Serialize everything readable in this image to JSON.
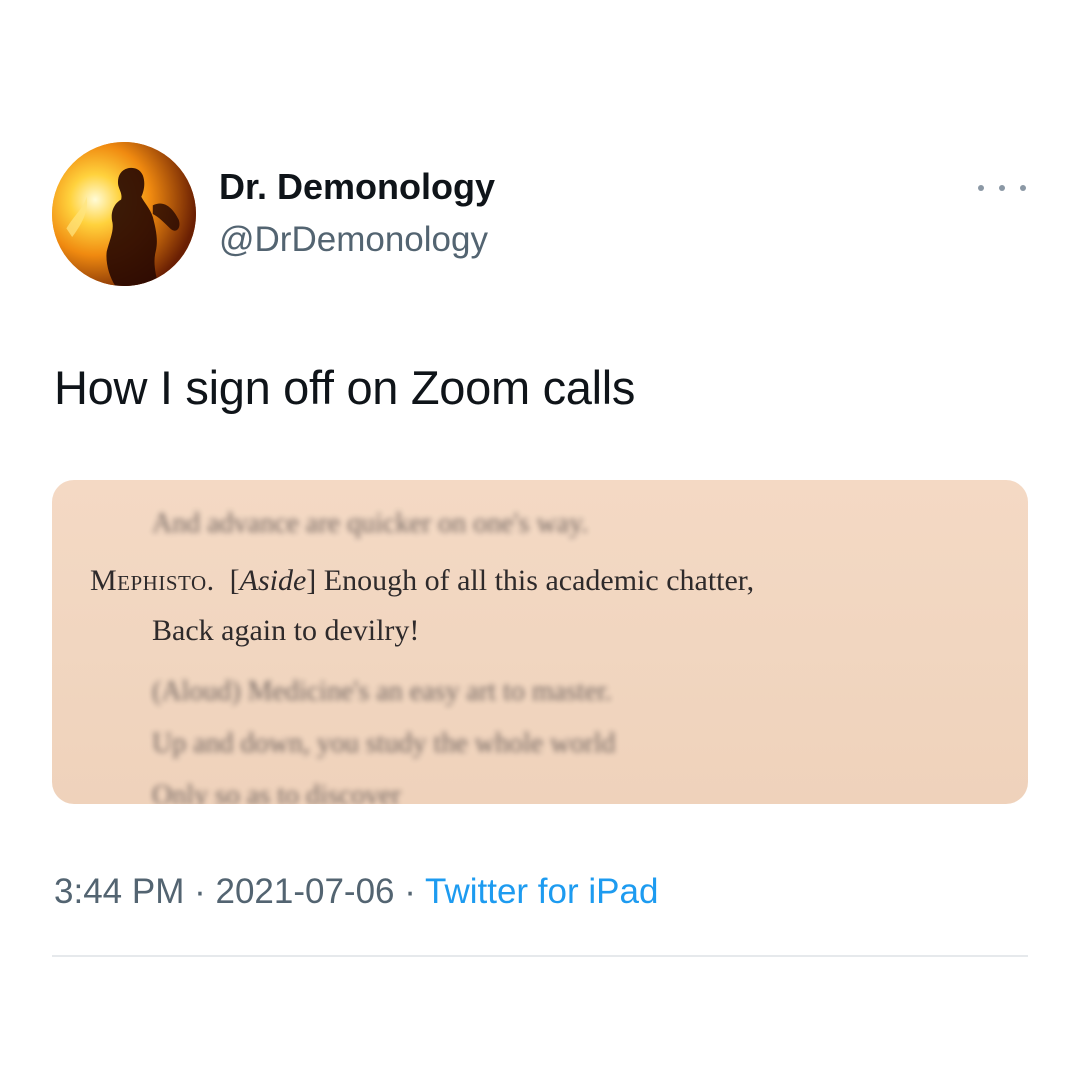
{
  "author": {
    "display_name": "Dr. Demonology",
    "handle": "@DrDemonology"
  },
  "tweet": {
    "text": "How I sign off on Zoom calls"
  },
  "media": {
    "blurred_top": "And advance are quicker on one's way.",
    "speaker": "Mephisto.",
    "aside": "Aside",
    "line1_rest": "Enough of all this academic chatter,",
    "line2": "Back again to devilry!",
    "blurred_lines": [
      "(Aloud) Medicine's an easy art to master.",
      "Up and down, you study the whole world",
      "Only so as to discover"
    ]
  },
  "meta": {
    "time": "3:44 PM",
    "separator": "·",
    "date": "2021-07-06",
    "source": "Twitter for iPad"
  },
  "colors": {
    "text_primary": "#0f1419",
    "text_secondary": "#536471",
    "link": "#1d9bf0",
    "page_paper": "#f2d7c1"
  },
  "icons": {
    "more": "more-dots-icon",
    "avatar": "fire-silhouette-avatar"
  }
}
